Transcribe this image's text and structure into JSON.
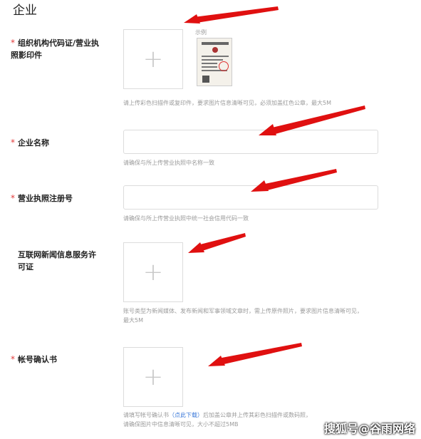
{
  "section_title": "企业",
  "example_label": "示例",
  "watermark": "搜狐号@谷雨网络",
  "fields": {
    "license_copy": {
      "required": "*",
      "label": "组织机构代码证/营业执照影印件",
      "hint": "请上传彩色扫描件或复印件，要求图片信息清晰可见，必须加盖红色公章，最大5M"
    },
    "company_name": {
      "required": "*",
      "label": "企业名称",
      "value": "",
      "hint": "请确保与所上传营业执照中名称一致"
    },
    "reg_number": {
      "required": "*",
      "label": "营业执照注册号",
      "value": "",
      "hint": "请确保与所上传营业执照中统一社会信用代码一致"
    },
    "internet_news_license": {
      "label": "互联网新闻信息服务许可证",
      "hint_line1": "账号类型为新闻媒体、发布新闻和军事领域文章时，需上传原件照片，要求图片信息清晰可见，",
      "hint_line2": "最大5M"
    },
    "account_confirmation": {
      "required": "*",
      "label": "帐号确认书",
      "hint_prefix": "请填写帐号确认书",
      "hint_link": "（点此下载）",
      "hint_suffix": "后加盖公章并上传其彩色扫描件或数码照，",
      "hint_line2": "请确保图片中信息清晰可见，大小不超过5MB"
    }
  },
  "colors": {
    "required_star": "#e23b3b",
    "link": "#3a78d8",
    "annotation_arrow": "#e01010"
  },
  "icons": {
    "upload": "plus-icon",
    "annotation": "red-arrow"
  }
}
